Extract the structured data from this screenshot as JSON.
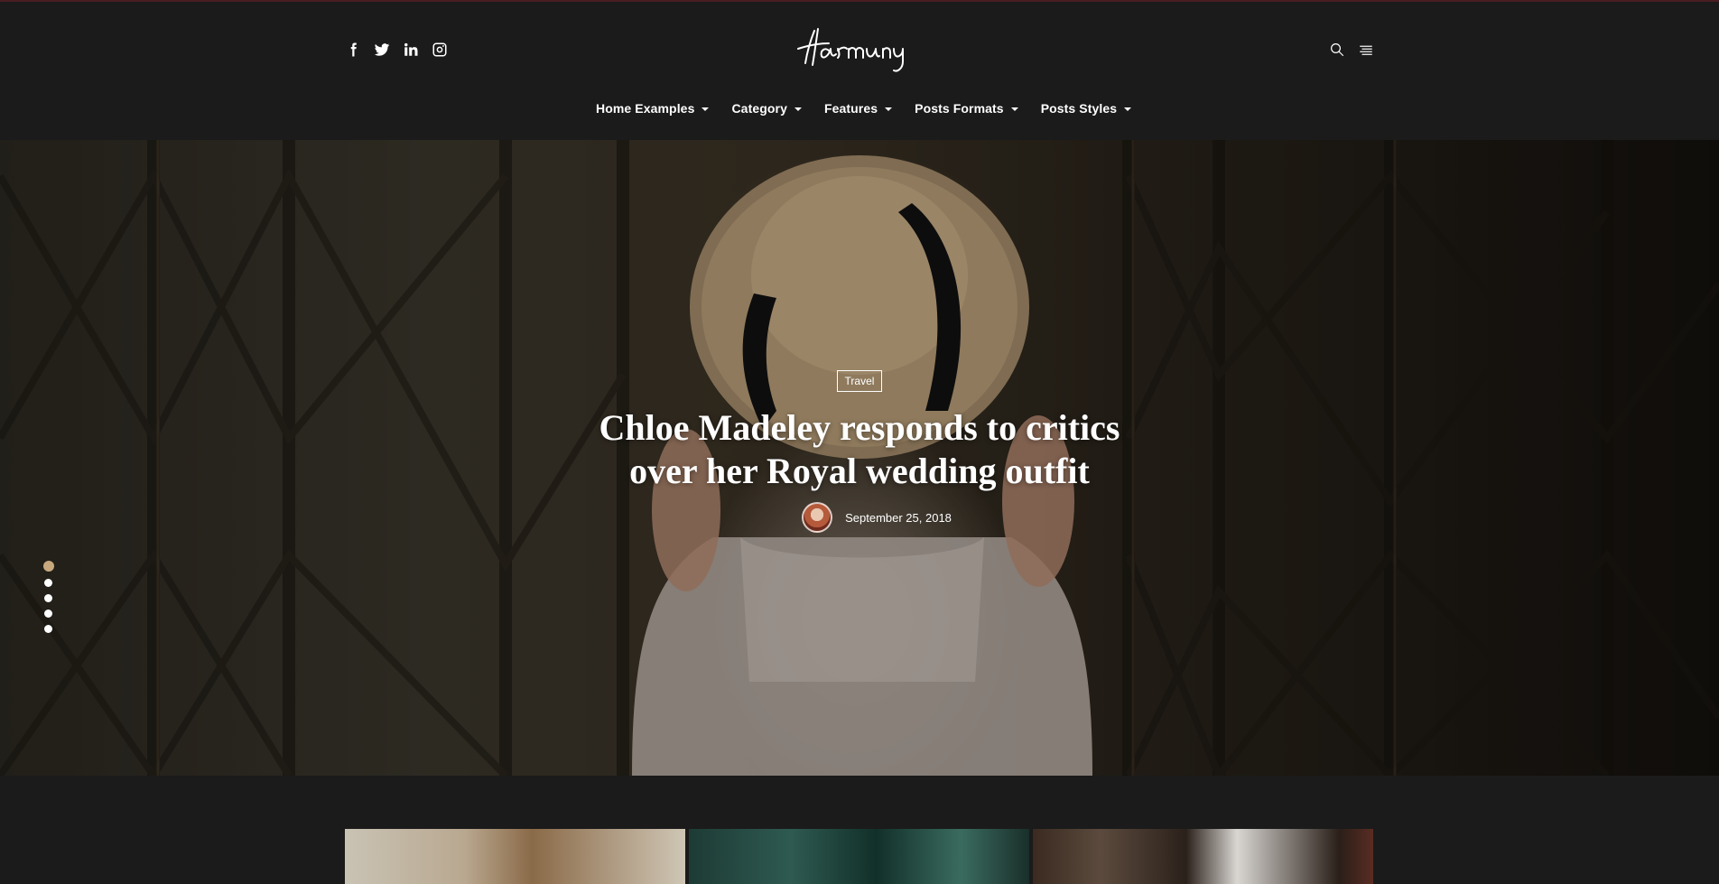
{
  "site": {
    "logo_text": "Harmony"
  },
  "social": [
    {
      "name": "facebook-icon"
    },
    {
      "name": "twitter-icon"
    },
    {
      "name": "linkedin-icon"
    },
    {
      "name": "instagram-icon"
    }
  ],
  "tools": {
    "search_icon": "search-icon",
    "menu_icon": "hamburger-menu-icon"
  },
  "nav": {
    "items": [
      {
        "label": "Home Examples"
      },
      {
        "label": "Category"
      },
      {
        "label": "Features"
      },
      {
        "label": "Posts Formats"
      },
      {
        "label": "Posts Styles"
      }
    ]
  },
  "hero": {
    "category": "Travel",
    "title_line1": "Chloe Madeley responds to critics",
    "title_line2": "over her Royal wedding outfit",
    "date": "September 25, 2018",
    "slides_count": 5,
    "active_slide": 1
  },
  "colors": {
    "background": "#1b1b1b",
    "accent": "#c8a97e",
    "text": "#ffffff"
  }
}
